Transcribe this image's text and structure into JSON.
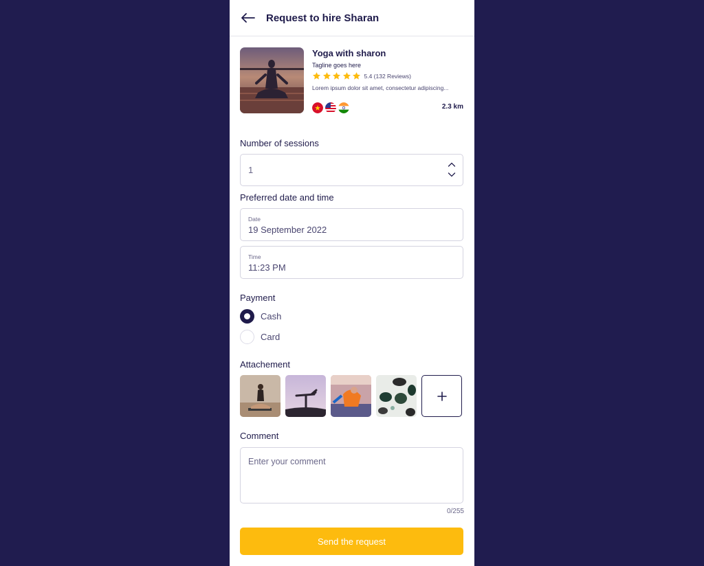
{
  "header": {
    "title": "Request to hire Sharan",
    "back_icon": "arrow-left-icon"
  },
  "profile": {
    "name": "Yoga with sharon",
    "tagline": "Tagline goes here",
    "rating_stars": 5,
    "rating_text": "5.4 (132 Reviews)",
    "description": "Lorem ipsum dolor sit amet, consectetur adipiscing...",
    "flags": [
      "vietnam-flag-icon",
      "usa-flag-icon",
      "india-flag-icon"
    ],
    "distance": "2.3 km"
  },
  "sessions": {
    "label": "Number of sessions",
    "value": "1"
  },
  "datetime": {
    "label": "Preferred date and time",
    "date_label": "Date",
    "date_value": "19 September 2022",
    "time_label": "Time",
    "time_value": "11:23 PM"
  },
  "payment": {
    "label": "Payment",
    "options": [
      {
        "label": "Cash",
        "selected": true
      },
      {
        "label": "Card",
        "selected": false
      }
    ]
  },
  "attachment": {
    "label": "Attachement",
    "add_icon": "plus-icon"
  },
  "comment": {
    "label": "Comment",
    "placeholder": "Enter your comment",
    "counter": "0/255"
  },
  "submit": {
    "label": "Send the request"
  },
  "colors": {
    "primary": "#1f1b4b",
    "accent": "#fdbb0e",
    "background": "#201c4f"
  }
}
